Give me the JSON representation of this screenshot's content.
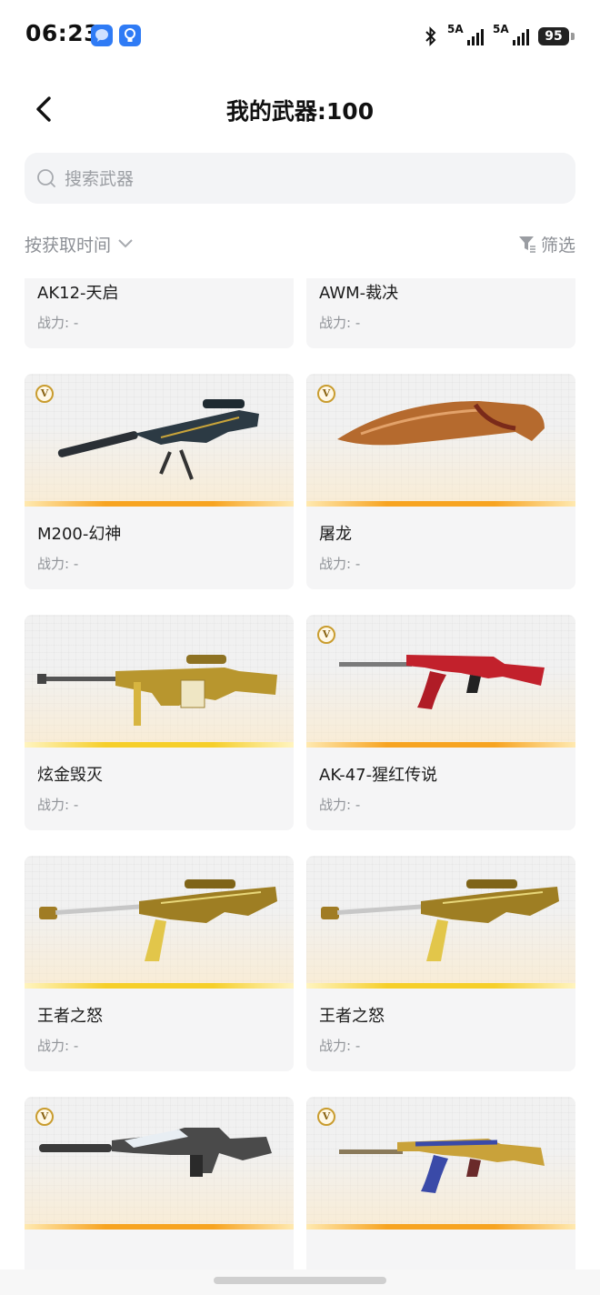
{
  "status_bar": {
    "time": "06:23",
    "app_icons": [
      "message-icon",
      "lightbulb-icon"
    ],
    "bluetooth_icon": "bluetooth-icon",
    "signals": [
      {
        "label": "5A"
      },
      {
        "label": "5A"
      }
    ],
    "battery": "95"
  },
  "header": {
    "back_icon": "chevron-left-icon",
    "title": "我的武器:100"
  },
  "search": {
    "placeholder": "搜索武器",
    "value": ""
  },
  "toolbar": {
    "sort_label": "按获取时间",
    "filter_label": "筛选"
  },
  "weapons": [
    {
      "name": "AK12-天启",
      "power": "战力: -",
      "badge": "",
      "art": "none",
      "bar": "orange"
    },
    {
      "name": "AWM-裁决",
      "power": "战力: -",
      "badge": "",
      "art": "none",
      "bar": "orange"
    },
    {
      "name": "M200-幻神",
      "power": "战力: -",
      "badge": "V",
      "art": "sniper-dark",
      "bar": "orange"
    },
    {
      "name": "屠龙",
      "power": "战力: -",
      "badge": "V",
      "art": "machete",
      "bar": "orange"
    },
    {
      "name": "炫金毁灭",
      "power": "战力: -",
      "badge": "",
      "art": "heavy-gold",
      "bar": "gold"
    },
    {
      "name": "AK-47-猩红传说",
      "power": "战力: -",
      "badge": "V",
      "art": "ak-red",
      "bar": "orange"
    },
    {
      "name": "王者之怒",
      "power": "战力: -",
      "badge": "",
      "art": "barrett-gold",
      "bar": "gold"
    },
    {
      "name": "王者之怒",
      "power": "战力: -",
      "badge": "",
      "art": "barrett-gold",
      "bar": "gold"
    },
    {
      "name": "",
      "power": "",
      "badge": "V",
      "art": "m4-silver",
      "bar": "orange"
    },
    {
      "name": "",
      "power": "",
      "badge": "V",
      "art": "ak-blue-gold",
      "bar": "orange"
    }
  ],
  "colors": {
    "accent_orange": "#f7a421",
    "accent_gold": "#f6cf2a",
    "muted_text": "#8c8f95"
  }
}
